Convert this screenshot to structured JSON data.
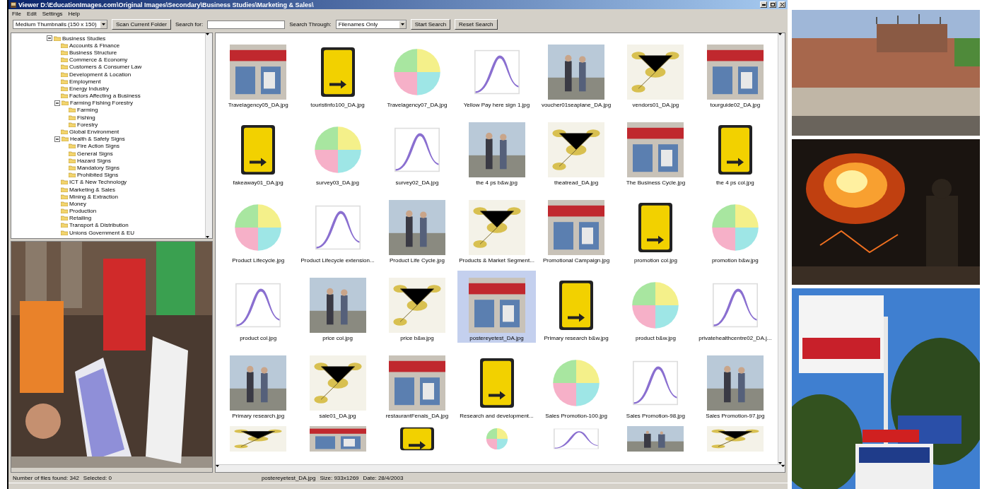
{
  "window": {
    "title": "Viewer D:\\EducationImages.com\\Original Images\\Secondary\\Business Studies\\Marketing & Sales\\"
  },
  "menu": [
    "File",
    "Edit",
    "Settings",
    "Help"
  ],
  "toolbar": {
    "view_select": "Medium Thumbnails (150 x 150)",
    "scan_button": "Scan Current Folder",
    "search_label": "Search for:",
    "search_through_label": "Search Through:",
    "search_through_select": "Filenames Only",
    "start_button": "Start Search",
    "reset_button": "Reset Search"
  },
  "tree": [
    {
      "label": "Business Studies",
      "expanded": true,
      "children": [
        {
          "label": "Accounts & Finance"
        },
        {
          "label": "Business Structure"
        },
        {
          "label": "Commerce & Economy"
        },
        {
          "label": "Customers & Consumer Law"
        },
        {
          "label": "Development & Location"
        },
        {
          "label": "Employment"
        },
        {
          "label": "Energy Industry"
        },
        {
          "label": "Factors Affecting a Business"
        },
        {
          "label": "Farming Fishing Forestry",
          "expanded": true,
          "children": [
            {
              "label": "Farming"
            },
            {
              "label": "Fishing"
            },
            {
              "label": "Forestry"
            }
          ]
        },
        {
          "label": "Global Environment"
        },
        {
          "label": "Health & Safety Signs",
          "expanded": true,
          "children": [
            {
              "label": "Fire Action Signs"
            },
            {
              "label": "General Signs"
            },
            {
              "label": "Hazard Signs"
            },
            {
              "label": "Mandatory Signs"
            },
            {
              "label": "Prohibited Signs"
            }
          ]
        },
        {
          "label": "ICT & New Technology"
        },
        {
          "label": "Marketing & Sales"
        },
        {
          "label": "Mining & Extraction"
        },
        {
          "label": "Money"
        },
        {
          "label": "Production"
        },
        {
          "label": "Retailing"
        },
        {
          "label": "Transport & Distribution"
        },
        {
          "label": "Unions Government & EU"
        }
      ]
    }
  ],
  "thumbnails": [
    {
      "label": "Travelagency05_DA.jpg",
      "selected": false
    },
    {
      "label": "touristinfo100_DA.jpg",
      "selected": false
    },
    {
      "label": "Travelagency07_DA.jpg",
      "selected": false
    },
    {
      "label": "Yellow Pay here sign 1.jpg",
      "selected": false
    },
    {
      "label": "voucher01seaplane_DA.jpg",
      "selected": false
    },
    {
      "label": "vendors01_DA.jpg",
      "selected": false
    },
    {
      "label": "tourguide02_DA.jpg",
      "selected": false
    },
    {
      "label": "fakeaway01_DA.jpg",
      "selected": false
    },
    {
      "label": "survey03_DA.jpg",
      "selected": false
    },
    {
      "label": "survey02_DA.jpg",
      "selected": false
    },
    {
      "label": "the 4 ps b&w.jpg",
      "selected": false
    },
    {
      "label": "theatread_DA.jpg",
      "selected": false
    },
    {
      "label": "The Business Cycle.jpg",
      "selected": false
    },
    {
      "label": "the 4 ps col.jpg",
      "selected": false
    },
    {
      "label": "Product Lifecycle.jpg",
      "selected": false
    },
    {
      "label": "Product Lifecycle extension...",
      "selected": false
    },
    {
      "label": "Product Life Cycle.jpg",
      "selected": false
    },
    {
      "label": "Products & Market Segment...",
      "selected": false
    },
    {
      "label": "Promotional Campaign.jpg",
      "selected": false
    },
    {
      "label": "promotion col.jpg",
      "selected": false
    },
    {
      "label": "promotion b&w.jpg",
      "selected": false
    },
    {
      "label": "product col.jpg",
      "selected": false
    },
    {
      "label": "price col.jpg",
      "selected": false
    },
    {
      "label": "price b&w.jpg",
      "selected": false
    },
    {
      "label": "postereyetest_DA.jpg",
      "selected": true
    },
    {
      "label": "Primary research b&w.jpg",
      "selected": false
    },
    {
      "label": "product b&w.jpg",
      "selected": false
    },
    {
      "label": "privatehealthcentre02_DA.j...",
      "selected": false
    },
    {
      "label": "Primary research.jpg",
      "selected": false
    },
    {
      "label": "sale01_DA.jpg",
      "selected": false
    },
    {
      "label": "restaurantFenals_DA.jpg",
      "selected": false
    },
    {
      "label": "Research and development...",
      "selected": false
    },
    {
      "label": "Sales Promotion-100.jpg",
      "selected": false
    },
    {
      "label": "Sales Promotion-98.jpg",
      "selected": false
    },
    {
      "label": "Sales Promotion-97.jpg",
      "selected": false
    },
    {
      "selected": false
    },
    {
      "selected": false
    },
    {
      "selected": false
    },
    {
      "selected": false
    },
    {
      "selected": false
    },
    {
      "selected": false
    },
    {
      "selected": false
    }
  ],
  "status_bar": {
    "count": "Number of files found: 342",
    "selected_count": "Selected: 0",
    "file": "postereyetest_DA.jpg",
    "size": "Size: 933x1269",
    "date": "Date: 28/4/2003"
  }
}
